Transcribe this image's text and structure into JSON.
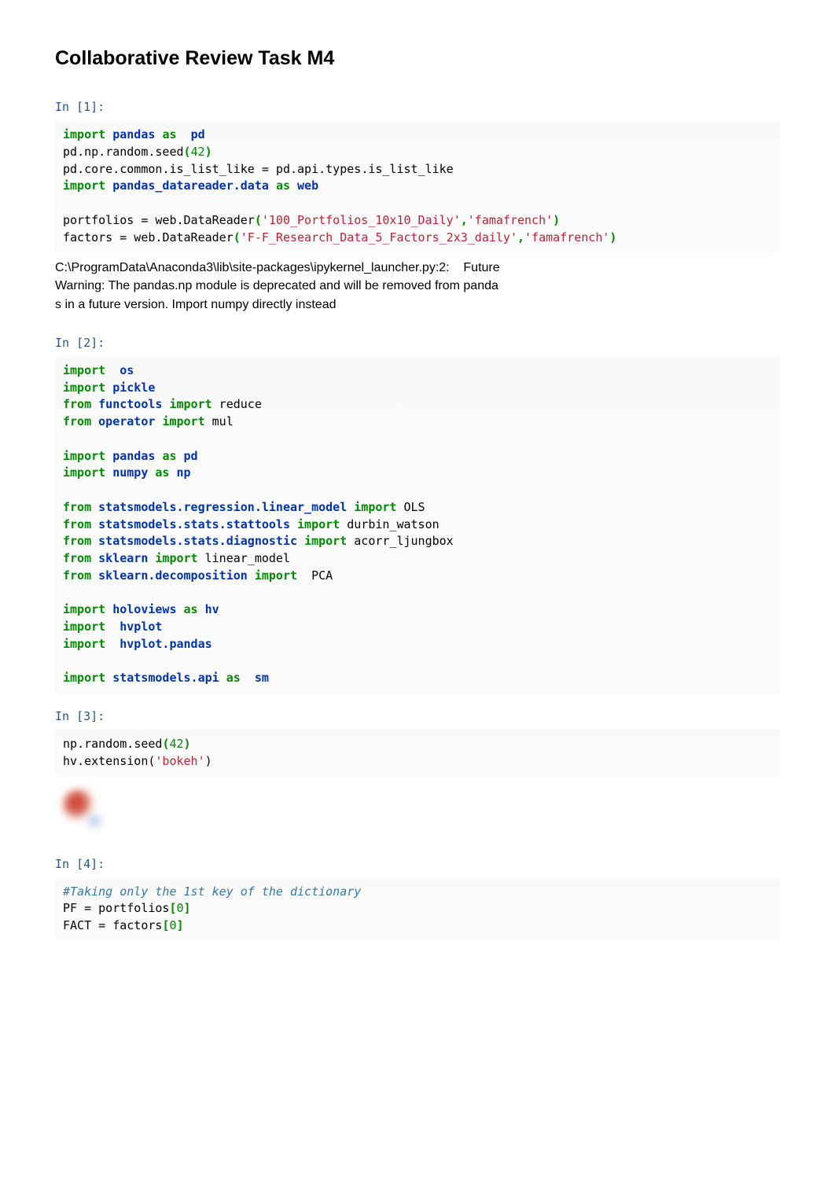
{
  "title": "Collaborative Review Task M4",
  "cells": [
    {
      "prompt": "In [1]:",
      "tokens": [
        {
          "t": "import",
          "c": "kw-green"
        },
        {
          "t": " ",
          "c": "plain"
        },
        {
          "t": "pandas",
          "c": "kw-blue"
        },
        {
          "t": " ",
          "c": "plain"
        },
        {
          "t": "as",
          "c": "kw-green"
        },
        {
          "t": "  ",
          "c": "plain"
        },
        {
          "t": "pd",
          "c": "kw-blue"
        },
        {
          "t": "\n",
          "c": "plain"
        },
        {
          "t": "pd",
          "c": "plain"
        },
        {
          "t": ".",
          "c": "plain"
        },
        {
          "t": "np",
          "c": "plain"
        },
        {
          "t": ".",
          "c": "plain"
        },
        {
          "t": "random",
          "c": "plain"
        },
        {
          "t": ".",
          "c": "plain"
        },
        {
          "t": "seed",
          "c": "plain"
        },
        {
          "t": "(",
          "c": "kw-green"
        },
        {
          "t": "42",
          "c": "num"
        },
        {
          "t": ")",
          "c": "kw-green"
        },
        {
          "t": "\n",
          "c": "plain"
        },
        {
          "t": "pd",
          "c": "plain"
        },
        {
          "t": ".",
          "c": "plain"
        },
        {
          "t": "core",
          "c": "plain"
        },
        {
          "t": ".",
          "c": "plain"
        },
        {
          "t": "common",
          "c": "plain"
        },
        {
          "t": ".",
          "c": "plain"
        },
        {
          "t": "is_list_like ",
          "c": "plain"
        },
        {
          "t": "=",
          "c": "plain"
        },
        {
          "t": " pd",
          "c": "plain"
        },
        {
          "t": ".",
          "c": "plain"
        },
        {
          "t": "api",
          "c": "plain"
        },
        {
          "t": ".",
          "c": "plain"
        },
        {
          "t": "types",
          "c": "plain"
        },
        {
          "t": ".",
          "c": "plain"
        },
        {
          "t": "is_list_like",
          "c": "plain"
        },
        {
          "t": "\n",
          "c": "plain"
        },
        {
          "t": "import",
          "c": "kw-green"
        },
        {
          "t": " ",
          "c": "plain"
        },
        {
          "t": "pandas_datareader.data",
          "c": "kw-blue"
        },
        {
          "t": " ",
          "c": "plain"
        },
        {
          "t": "as",
          "c": "kw-green"
        },
        {
          "t": " ",
          "c": "plain"
        },
        {
          "t": "web",
          "c": "kw-blue"
        },
        {
          "t": "\n\n",
          "c": "plain"
        },
        {
          "t": "portfolios ",
          "c": "plain"
        },
        {
          "t": "=",
          "c": "plain"
        },
        {
          "t": " web",
          "c": "plain"
        },
        {
          "t": ".",
          "c": "plain"
        },
        {
          "t": "DataReader",
          "c": "plain"
        },
        {
          "t": "(",
          "c": "kw-green"
        },
        {
          "t": "'100_Portfolios_10x10_Daily'",
          "c": "str"
        },
        {
          "t": ",",
          "c": "kw-green"
        },
        {
          "t": "'famafrench'",
          "c": "str"
        },
        {
          "t": ")",
          "c": "kw-green"
        },
        {
          "t": "\n",
          "c": "plain"
        },
        {
          "t": "factors ",
          "c": "plain"
        },
        {
          "t": "=",
          "c": "plain"
        },
        {
          "t": " web",
          "c": "plain"
        },
        {
          "t": ".",
          "c": "plain"
        },
        {
          "t": "DataReader",
          "c": "plain"
        },
        {
          "t": "(",
          "c": "kw-green"
        },
        {
          "t": "'F-F_Research_Data_5_Factors_2x3_daily'",
          "c": "str"
        },
        {
          "t": ",",
          "c": "kw-green"
        },
        {
          "t": "'famafrench'",
          "c": "str"
        },
        {
          "t": ")",
          "c": "kw-green"
        }
      ],
      "output": "C:\\ProgramData\\Anaconda3\\lib\\site-packages\\ipykernel_launcher.py:2:    Future\nWarning: The pandas.np module is deprecated and will be removed from panda\ns in a future version. Import numpy directly instead"
    },
    {
      "prompt": "In [2]:",
      "tokens": [
        {
          "t": "import",
          "c": "kw-green"
        },
        {
          "t": "  ",
          "c": "plain"
        },
        {
          "t": "os",
          "c": "kw-blue"
        },
        {
          "t": "\n",
          "c": "plain"
        },
        {
          "t": "import",
          "c": "kw-green"
        },
        {
          "t": " ",
          "c": "plain"
        },
        {
          "t": "pickle",
          "c": "kw-blue"
        },
        {
          "t": "\n",
          "c": "plain"
        },
        {
          "t": "from",
          "c": "kw-green"
        },
        {
          "t": " ",
          "c": "plain"
        },
        {
          "t": "functools",
          "c": "kw-blue"
        },
        {
          "t": " ",
          "c": "plain"
        },
        {
          "t": "import",
          "c": "kw-green"
        },
        {
          "t": " reduce",
          "c": "plain"
        },
        {
          "t": "\n",
          "c": "plain"
        },
        {
          "t": "from",
          "c": "kw-green"
        },
        {
          "t": " ",
          "c": "plain"
        },
        {
          "t": "operator",
          "c": "kw-blue"
        },
        {
          "t": " ",
          "c": "plain"
        },
        {
          "t": "import",
          "c": "kw-green"
        },
        {
          "t": " mul",
          "c": "plain"
        },
        {
          "t": "\n\n",
          "c": "plain"
        },
        {
          "t": "import",
          "c": "kw-green"
        },
        {
          "t": " ",
          "c": "plain"
        },
        {
          "t": "pandas",
          "c": "kw-blue"
        },
        {
          "t": " ",
          "c": "plain"
        },
        {
          "t": "as",
          "c": "kw-green"
        },
        {
          "t": " ",
          "c": "plain"
        },
        {
          "t": "pd",
          "c": "kw-blue"
        },
        {
          "t": "\n",
          "c": "plain"
        },
        {
          "t": "import",
          "c": "kw-green"
        },
        {
          "t": " ",
          "c": "plain"
        },
        {
          "t": "numpy",
          "c": "kw-blue"
        },
        {
          "t": " ",
          "c": "plain"
        },
        {
          "t": "as",
          "c": "kw-green"
        },
        {
          "t": " ",
          "c": "plain"
        },
        {
          "t": "np",
          "c": "kw-blue"
        },
        {
          "t": "\n\n",
          "c": "plain"
        },
        {
          "t": "from",
          "c": "kw-green"
        },
        {
          "t": " ",
          "c": "plain"
        },
        {
          "t": "statsmodels.regression.linear_model",
          "c": "kw-blue"
        },
        {
          "t": " ",
          "c": "plain"
        },
        {
          "t": "import",
          "c": "kw-green"
        },
        {
          "t": " OLS",
          "c": "plain"
        },
        {
          "t": "\n",
          "c": "plain"
        },
        {
          "t": "from",
          "c": "kw-green"
        },
        {
          "t": " ",
          "c": "plain"
        },
        {
          "t": "statsmodels.stats.stattools",
          "c": "kw-blue"
        },
        {
          "t": " ",
          "c": "plain"
        },
        {
          "t": "import",
          "c": "kw-green"
        },
        {
          "t": " durbin_watson",
          "c": "plain"
        },
        {
          "t": "\n",
          "c": "plain"
        },
        {
          "t": "from",
          "c": "kw-green"
        },
        {
          "t": " ",
          "c": "plain"
        },
        {
          "t": "statsmodels.stats.diagnostic",
          "c": "kw-blue"
        },
        {
          "t": " ",
          "c": "plain"
        },
        {
          "t": "import",
          "c": "kw-green"
        },
        {
          "t": " acorr_ljungbox",
          "c": "plain"
        },
        {
          "t": "\n",
          "c": "plain"
        },
        {
          "t": "from",
          "c": "kw-green"
        },
        {
          "t": " ",
          "c": "plain"
        },
        {
          "t": "sklearn",
          "c": "kw-blue"
        },
        {
          "t": " ",
          "c": "plain"
        },
        {
          "t": "import",
          "c": "kw-green"
        },
        {
          "t": " linear_model",
          "c": "plain"
        },
        {
          "t": "\n",
          "c": "plain"
        },
        {
          "t": "from",
          "c": "kw-green"
        },
        {
          "t": " ",
          "c": "plain"
        },
        {
          "t": "sklearn.decomposition",
          "c": "kw-blue"
        },
        {
          "t": " ",
          "c": "plain"
        },
        {
          "t": "import",
          "c": "kw-green"
        },
        {
          "t": "  PCA",
          "c": "plain"
        },
        {
          "t": "\n\n",
          "c": "plain"
        },
        {
          "t": "import",
          "c": "kw-green"
        },
        {
          "t": " ",
          "c": "plain"
        },
        {
          "t": "holoviews",
          "c": "kw-blue"
        },
        {
          "t": " ",
          "c": "plain"
        },
        {
          "t": "as",
          "c": "kw-green"
        },
        {
          "t": " ",
          "c": "plain"
        },
        {
          "t": "hv",
          "c": "kw-blue"
        },
        {
          "t": "\n",
          "c": "plain"
        },
        {
          "t": "import",
          "c": "kw-green"
        },
        {
          "t": "  ",
          "c": "plain"
        },
        {
          "t": "hvplot",
          "c": "kw-blue"
        },
        {
          "t": "\n",
          "c": "plain"
        },
        {
          "t": "import",
          "c": "kw-green"
        },
        {
          "t": "  ",
          "c": "plain"
        },
        {
          "t": "hvplot.pandas",
          "c": "kw-blue"
        },
        {
          "t": "\n\n",
          "c": "plain"
        },
        {
          "t": "import",
          "c": "kw-green"
        },
        {
          "t": " ",
          "c": "plain"
        },
        {
          "t": "statsmodels.api",
          "c": "kw-blue"
        },
        {
          "t": " ",
          "c": "plain"
        },
        {
          "t": "as",
          "c": "kw-green"
        },
        {
          "t": "  ",
          "c": "plain"
        },
        {
          "t": "sm",
          "c": "kw-blue"
        }
      ]
    },
    {
      "prompt": "In [3]:",
      "tokens": [
        {
          "t": "np",
          "c": "plain"
        },
        {
          "t": ".",
          "c": "plain"
        },
        {
          "t": "random",
          "c": "plain"
        },
        {
          "t": ".",
          "c": "plain"
        },
        {
          "t": "seed",
          "c": "plain"
        },
        {
          "t": "(",
          "c": "kw-green"
        },
        {
          "t": "42",
          "c": "num"
        },
        {
          "t": ")",
          "c": "kw-green"
        },
        {
          "t": "\n",
          "c": "plain"
        },
        {
          "t": "hv",
          "c": "plain"
        },
        {
          "t": ".",
          "c": "plain"
        },
        {
          "t": "extension(",
          "c": "plain"
        },
        {
          "t": "'bokeh'",
          "c": "str"
        },
        {
          "t": ")",
          "c": "plain"
        }
      ],
      "logo": true
    },
    {
      "prompt": "In [4]:",
      "tokens": [
        {
          "t": "#Taking only the 1st key of the dictionary",
          "c": "comment"
        },
        {
          "t": "\n",
          "c": "plain"
        },
        {
          "t": "PF ",
          "c": "plain"
        },
        {
          "t": "=",
          "c": "plain"
        },
        {
          "t": " portfolios",
          "c": "plain"
        },
        {
          "t": "[",
          "c": "kw-green"
        },
        {
          "t": "0",
          "c": "num"
        },
        {
          "t": "]",
          "c": "kw-green"
        },
        {
          "t": "\n",
          "c": "plain"
        },
        {
          "t": "FACT ",
          "c": "plain"
        },
        {
          "t": "=",
          "c": "plain"
        },
        {
          "t": " factors",
          "c": "plain"
        },
        {
          "t": "[",
          "c": "kw-green"
        },
        {
          "t": "0",
          "c": "num"
        },
        {
          "t": "]",
          "c": "kw-green"
        }
      ]
    }
  ]
}
